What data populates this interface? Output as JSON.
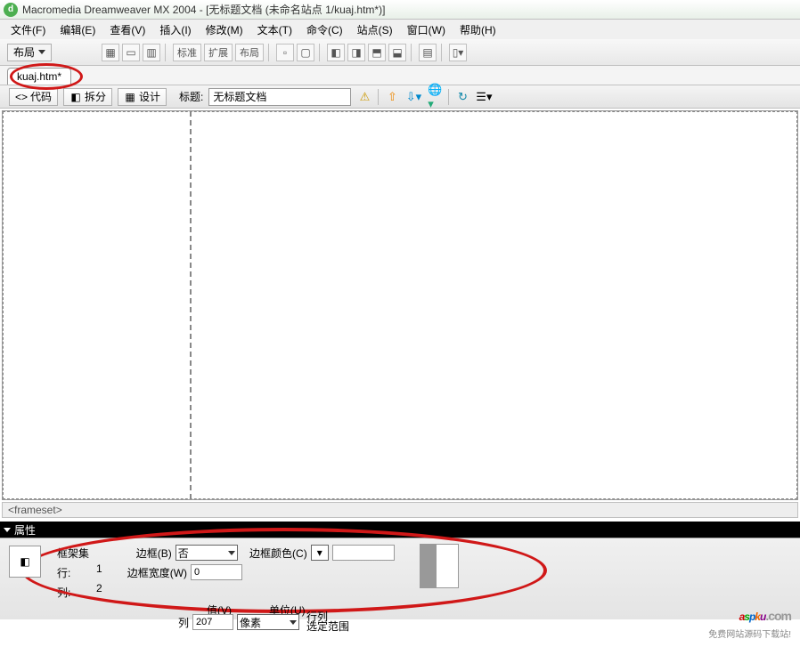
{
  "titlebar": {
    "app_icon_letter": "d",
    "text": "Macromedia Dreamweaver MX 2004 - [无标题文档 (未命名站点 1/kuaj.htm*)]"
  },
  "menu": {
    "file": "文件(F)",
    "edit": "编辑(E)",
    "view": "查看(V)",
    "insert": "插入(I)",
    "modify": "修改(M)",
    "text": "文本(T)",
    "commands": "命令(C)",
    "site": "站点(S)",
    "window": "窗口(W)",
    "help": "帮助(H)"
  },
  "toolbar": {
    "layout_label": "布局",
    "mode": {
      "standard": "标准",
      "expanded": "扩展",
      "layout": "布局"
    }
  },
  "filetab": {
    "name": "kuaj.htm*"
  },
  "secondbar": {
    "code": "代码",
    "split": "拆分",
    "design": "设计",
    "title_label": "标题:",
    "title_value": "无标题文档"
  },
  "statusbar": {
    "tag": "<frameset>"
  },
  "properties": {
    "panel_title": "属性",
    "frameset_label": "框架集",
    "rows_label": "行:",
    "rows_value": "1",
    "cols_label": "列:",
    "cols_value": "2",
    "border_label": "边框(B)",
    "border_value": "否",
    "border_width_label": "边框宽度(W)",
    "border_width_value": "0",
    "border_color_label": "边框颜色(C)",
    "value_label": "值(V)",
    "units_label": "单位(U)",
    "col_label2": "列",
    "col_value2": "207",
    "units_value": "像素",
    "rowcol_label": "行列",
    "range_label": "选定范围"
  },
  "watermark": {
    "logo": {
      "a": "a",
      "s": "s",
      "p": "p",
      "k": "k",
      "u": "u",
      "com": ".com"
    },
    "sub": "免费网站源码下载站!"
  }
}
